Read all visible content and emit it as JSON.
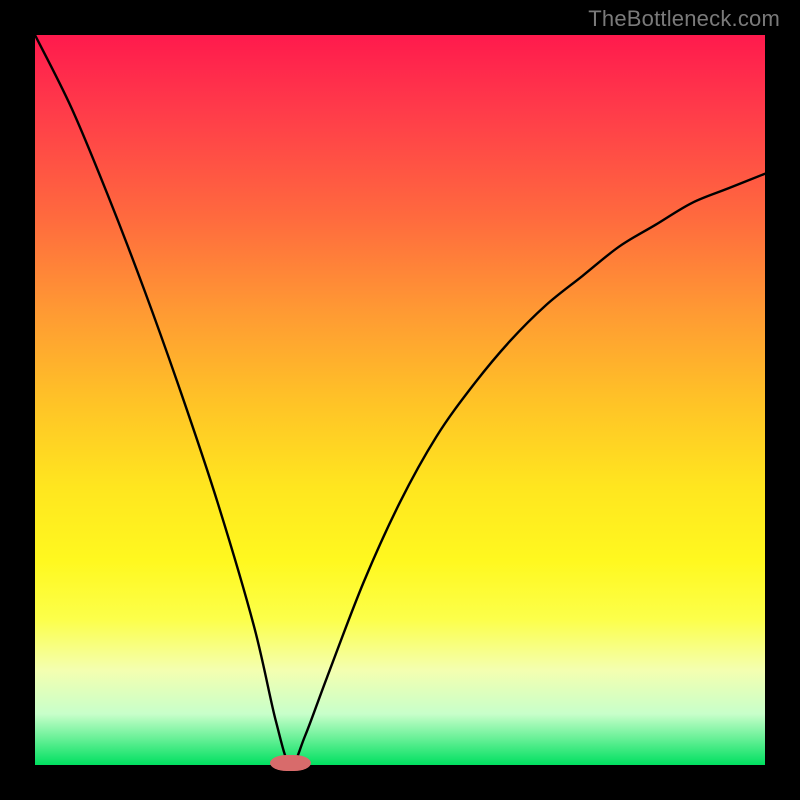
{
  "watermark": "TheBottleneck.com",
  "colors": {
    "frame": "#000000",
    "curve": "#000000",
    "bump": "#d86b6b",
    "gradient_top": "#ff1a4d",
    "gradient_bottom": "#00e060"
  },
  "chart_data": {
    "type": "line",
    "title": "",
    "xlabel": "",
    "ylabel": "",
    "xlim": [
      0,
      100
    ],
    "ylim": [
      0,
      100
    ],
    "grid": false,
    "note": "Axes are unlabeled in the source image; values below are pixel-fraction estimates read from the plot (0–100 on each axis, y increasing upward). The curve is a V-shaped bottleneck function touching ~0 near x≈35.",
    "series": [
      {
        "name": "bottleneck-curve",
        "x": [
          0,
          5,
          10,
          15,
          20,
          25,
          30,
          33,
          35,
          37,
          40,
          45,
          50,
          55,
          60,
          65,
          70,
          75,
          80,
          85,
          90,
          95,
          100
        ],
        "y": [
          100,
          90,
          78,
          65,
          51,
          36,
          19,
          6,
          0,
          4,
          12,
          25,
          36,
          45,
          52,
          58,
          63,
          67,
          71,
          74,
          77,
          79,
          81
        ]
      }
    ],
    "bump_marker": {
      "x": 35,
      "y": 0,
      "width_pct": 5.5,
      "height_pct": 2.2
    }
  }
}
